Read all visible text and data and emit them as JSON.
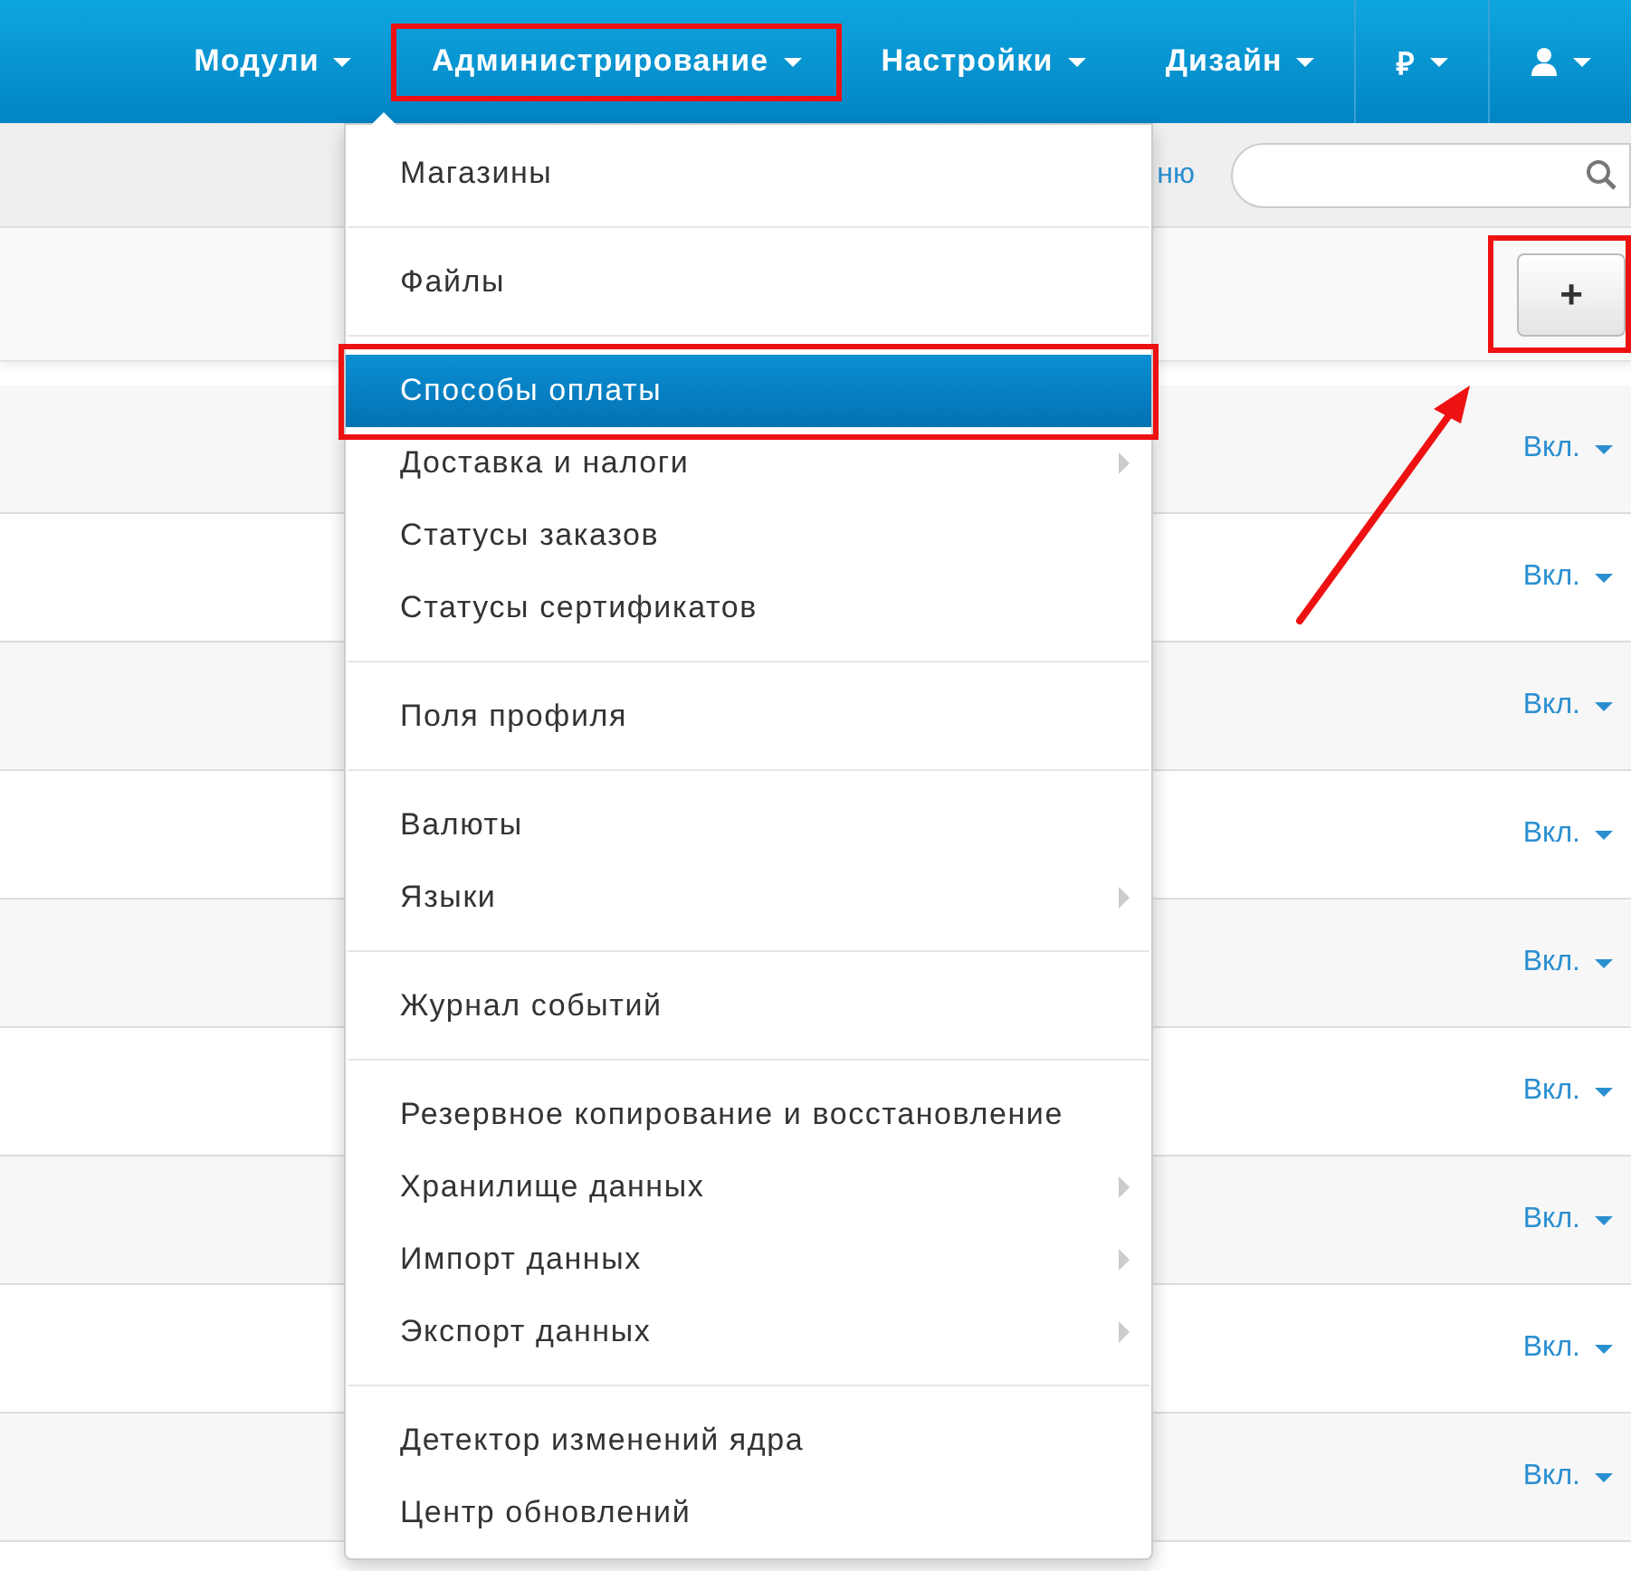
{
  "navbar": {
    "items": [
      {
        "kind": "text",
        "label": "Модули",
        "highlighted": false,
        "divider": false
      },
      {
        "kind": "text",
        "label": "Администрирование",
        "highlighted": true,
        "divider": false
      },
      {
        "kind": "text",
        "label": "Настройки",
        "highlighted": false,
        "divider": false
      },
      {
        "kind": "text",
        "label": "Дизайн",
        "highlighted": false,
        "divider": false
      },
      {
        "kind": "text",
        "label": "₽",
        "highlighted": false,
        "divider": true
      },
      {
        "kind": "user",
        "highlighted": false,
        "divider": true
      }
    ]
  },
  "subbar": {
    "link": "ню"
  },
  "toolbar": {
    "add_button": {
      "label": "+",
      "highlighted": true
    }
  },
  "dropdown": {
    "sections": [
      [
        {
          "label": "Магазины",
          "selected": false,
          "submenu": false
        }
      ],
      [
        {
          "label": "Файлы",
          "selected": false,
          "submenu": false
        }
      ],
      [
        {
          "label": "Способы оплаты",
          "selected": true,
          "submenu": false
        },
        {
          "label": "Доставка и налоги",
          "selected": false,
          "submenu": true
        },
        {
          "label": "Статусы заказов",
          "selected": false,
          "submenu": false
        },
        {
          "label": "Статусы сертификатов",
          "selected": false,
          "submenu": false
        }
      ],
      [
        {
          "label": "Поля профиля",
          "selected": false,
          "submenu": false
        }
      ],
      [
        {
          "label": "Валюты",
          "selected": false,
          "submenu": false
        },
        {
          "label": "Языки",
          "selected": false,
          "submenu": true
        }
      ],
      [
        {
          "label": "Журнал событий",
          "selected": false,
          "submenu": false
        }
      ],
      [
        {
          "label": "Резервное копирование и восстановление",
          "selected": false,
          "submenu": false
        },
        {
          "label": "Хранилище данных",
          "selected": false,
          "submenu": true
        },
        {
          "label": "Импорт данных",
          "selected": false,
          "submenu": true
        },
        {
          "label": "Экспорт данных",
          "selected": false,
          "submenu": true
        }
      ],
      [
        {
          "label": "Детектор изменений ядра",
          "selected": false,
          "submenu": false
        },
        {
          "label": "Центр обновлений",
          "selected": false,
          "submenu": false
        }
      ]
    ]
  },
  "rows": [
    {
      "status": "Вкл."
    },
    {
      "status": "Вкл."
    },
    {
      "status": "Вкл."
    },
    {
      "status": "Вкл."
    },
    {
      "status": "Вкл."
    },
    {
      "status": "Вкл."
    },
    {
      "status": "Вкл."
    },
    {
      "status": "Вкл."
    },
    {
      "status": "Вкл."
    }
  ]
}
